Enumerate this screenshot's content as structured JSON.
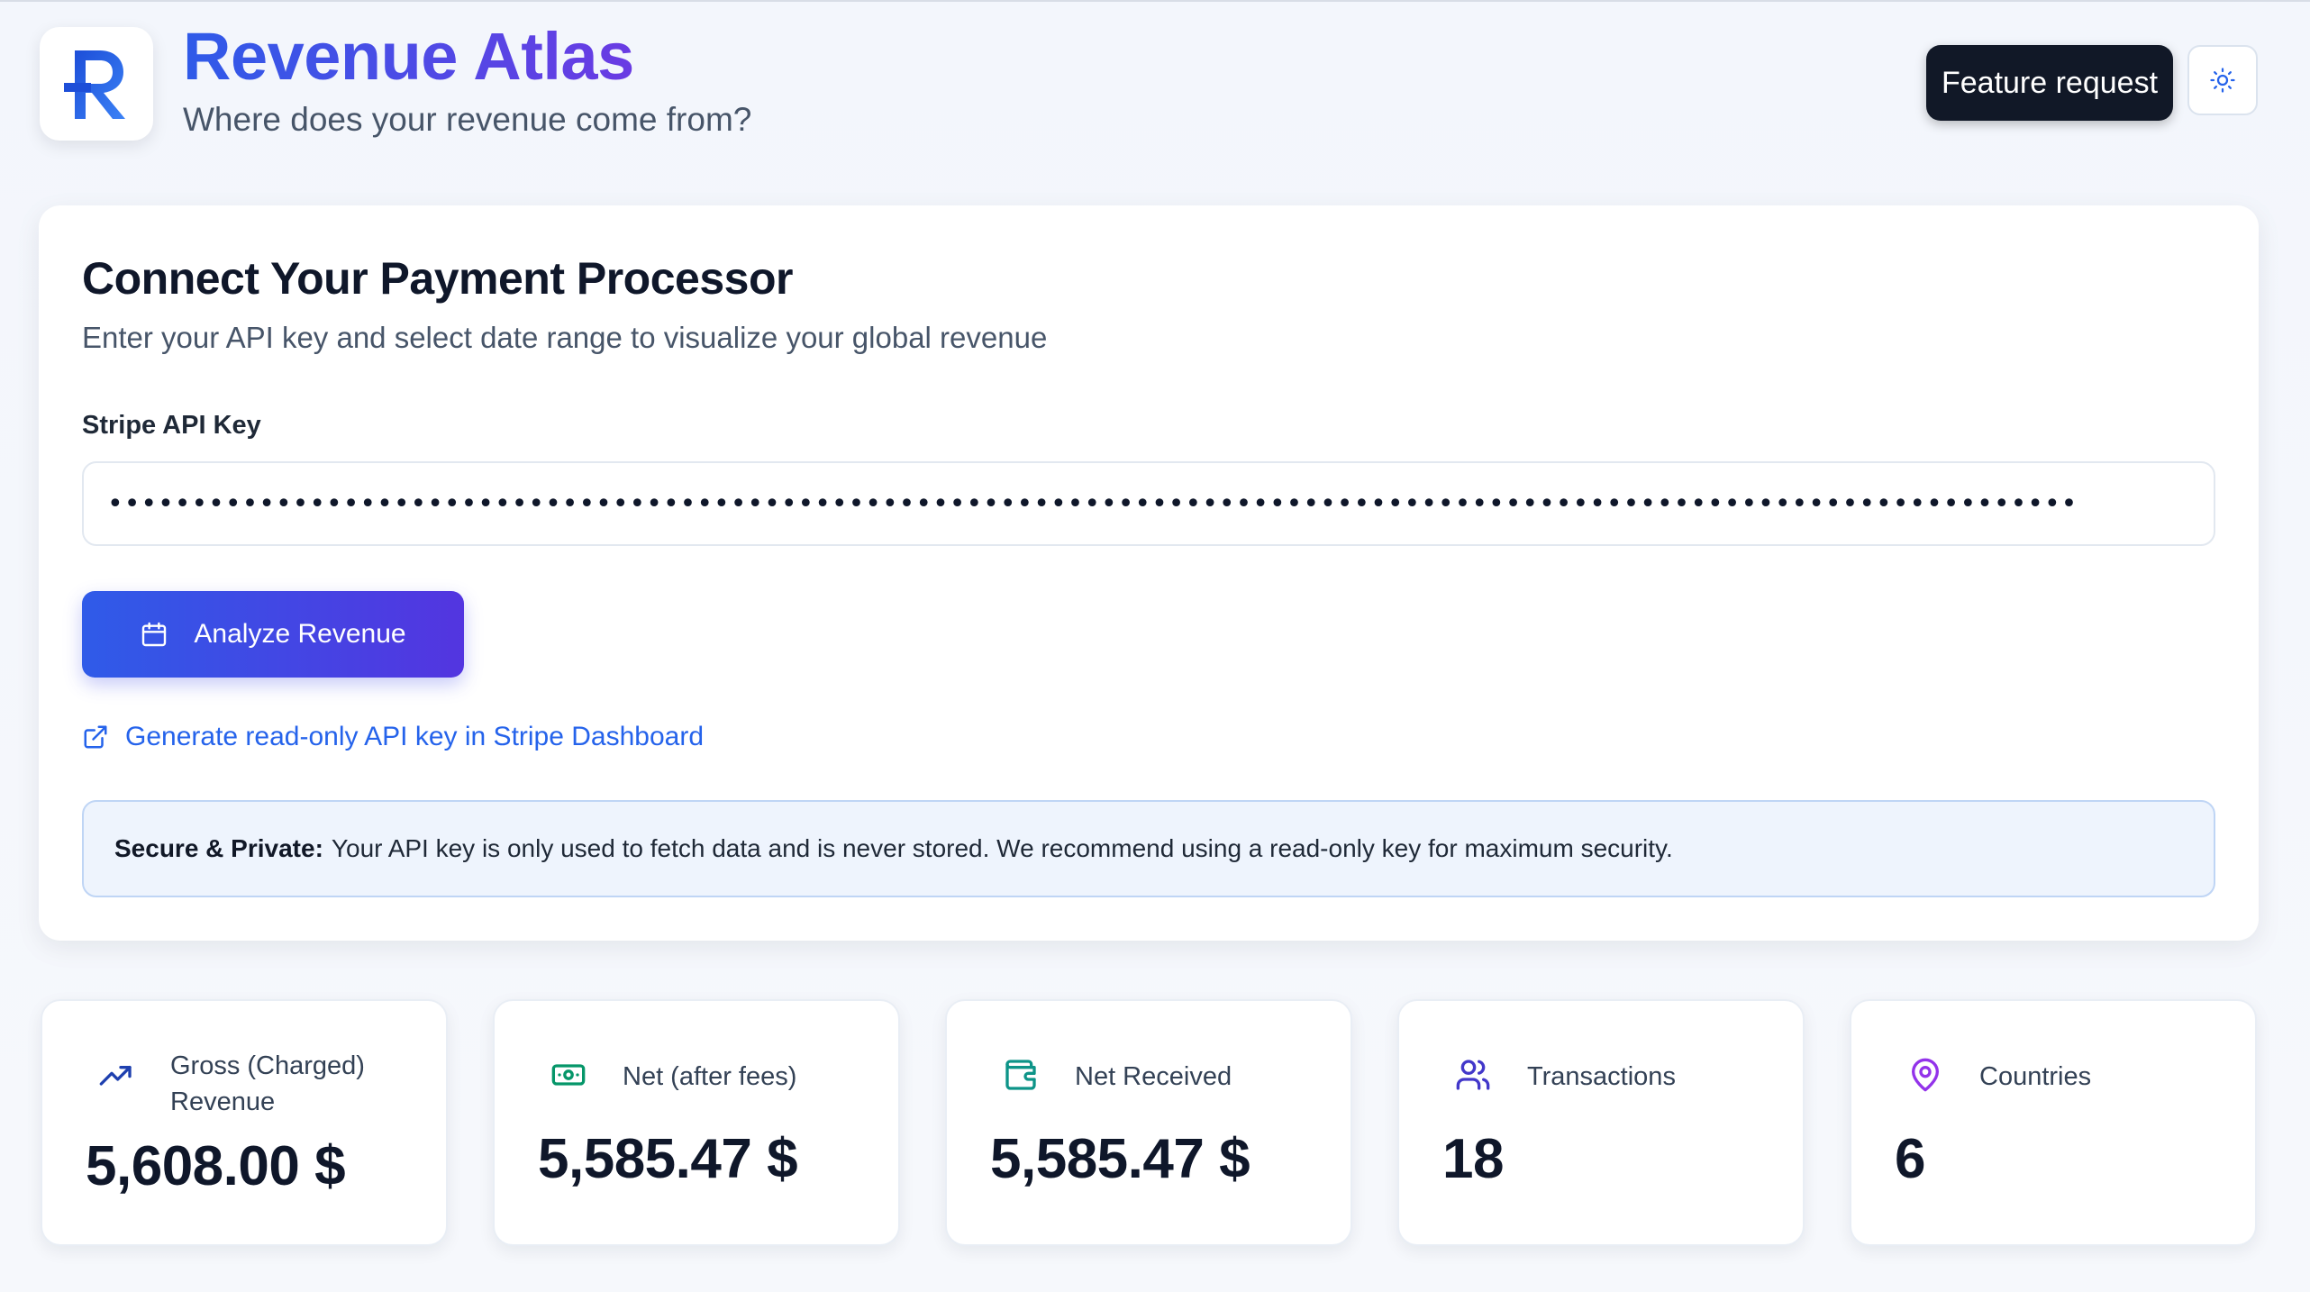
{
  "header": {
    "logo_letter": "R",
    "title": "Revenue Atlas",
    "subtitle": "Where does your revenue come from?",
    "feature_request_label": "Feature request",
    "theme_toggle_icon": "sun-icon"
  },
  "connect": {
    "title": "Connect Your Payment Processor",
    "description": "Enter your API key and select date range to visualize your global revenue",
    "api_key_label": "Stripe API Key",
    "api_key_value": "•••••••••••••••••••••••••••••••••••••••••••••••••••••••••••••••••••••••••••••••••••••••••••••••••••••••••••••••••••••",
    "analyze_label": "Analyze Revenue",
    "analyze_icon": "calendar-icon",
    "stripe_link_label": "Generate read-only API key in Stripe Dashboard",
    "stripe_link_icon": "external-link-icon",
    "notice_bold": "Secure & Private:",
    "notice_text": "Your API key is only used to fetch data and is never stored. We recommend using a read-only key for maximum security."
  },
  "stats": [
    {
      "label": "Gross (Charged) Revenue",
      "value": "5,608.00 $",
      "icon": "trending-up-icon",
      "color": "#1e40af"
    },
    {
      "label": "Net (after fees)",
      "value": "5,585.47 $",
      "icon": "banknote-icon",
      "color": "#059669"
    },
    {
      "label": "Net Received",
      "value": "5,585.47 $",
      "icon": "wallet-icon",
      "color": "#0d9488"
    },
    {
      "label": "Transactions",
      "value": "18",
      "icon": "users-icon",
      "color": "#4338ca"
    },
    {
      "label": "Countries",
      "value": "6",
      "icon": "map-pin-icon",
      "color": "#9333ea"
    }
  ]
}
